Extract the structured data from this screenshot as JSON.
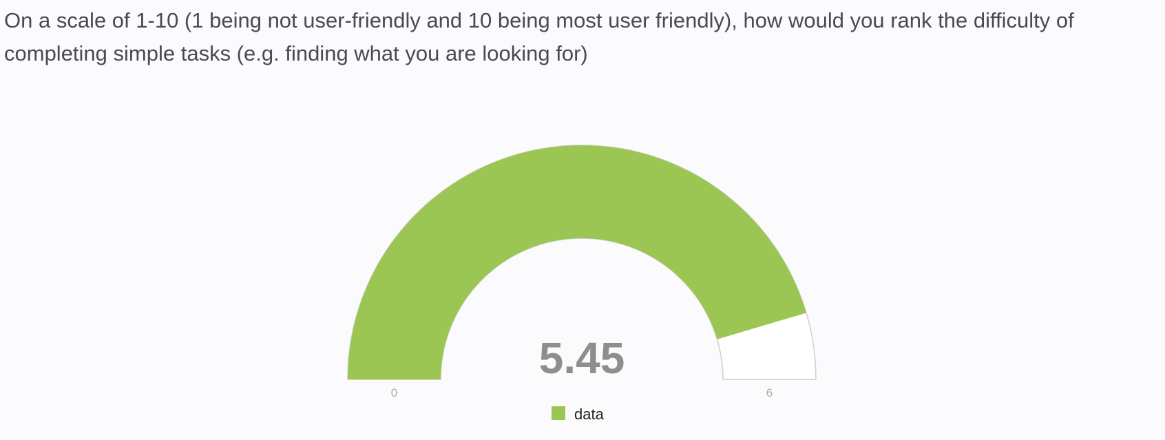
{
  "question": {
    "text": "On a scale of 1-10 (1 being not user-friendly and 10 being most user friendly), how would you rank the difficulty of completing simple tasks (e.g. finding what you are looking for)"
  },
  "colors": {
    "fill": "#9bc654",
    "track": "#ffffff",
    "track_border": "#cfcfcf",
    "value_text": "#8e8e8e",
    "tick_text": "#aaaaaa",
    "legend_text": "#222222"
  },
  "chart_data": {
    "type": "gauge",
    "value": 5.45,
    "value_label": "5.45",
    "min": 0,
    "max": 6,
    "min_label": "0",
    "max_label": "6",
    "legend": [
      {
        "name": "data",
        "color": "#9bc654"
      }
    ]
  }
}
